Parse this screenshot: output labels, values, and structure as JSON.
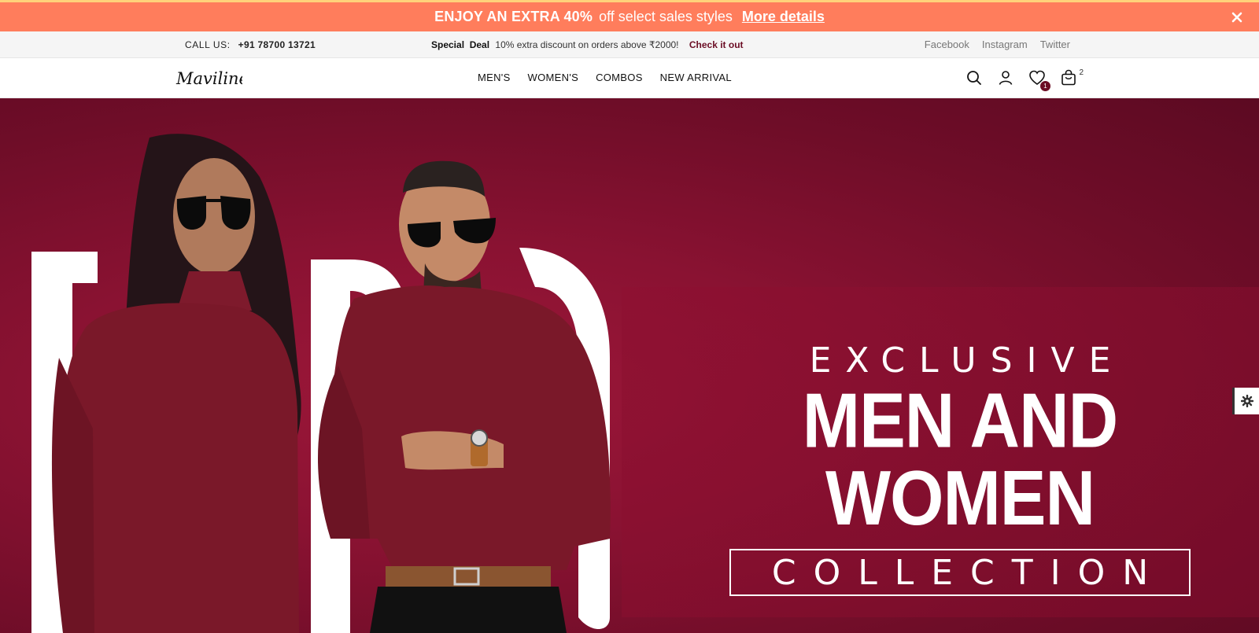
{
  "promo": {
    "strong": "ENJOY AN EXTRA 40%",
    "light": "off select sales styles",
    "link": "More details",
    "close_icon": "close-icon"
  },
  "infobar": {
    "call_label": "CALL US:",
    "phone": "+91 78700 13721",
    "deal_label": "Special  Deal",
    "deal_text": "10% extra discount on orders above ₹2000!",
    "deal_link": "Check it out",
    "social": [
      "Facebook",
      "Instagram",
      "Twitter"
    ]
  },
  "header": {
    "logo_text": "Mavilinen",
    "nav": [
      "MEN'S",
      "WOMEN'S",
      "COMBOS",
      "NEW ARRIVAL"
    ],
    "icons": [
      "search-icon",
      "user-icon",
      "heart-icon",
      "bag-icon"
    ],
    "wishlist_count": "1",
    "cart_count": "2"
  },
  "hero": {
    "line1": "EXCLUSIVE",
    "line2": "MEN AND WOMEN",
    "line3": "COLLECTION"
  },
  "colors": {
    "promo_bg": "#ff7d5c",
    "accent": "#6b0d24",
    "hero_bg": "#8a1232"
  }
}
